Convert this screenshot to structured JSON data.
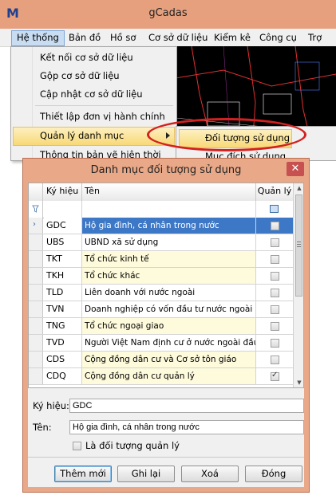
{
  "app": {
    "title": "gCadas",
    "menu": [
      "Hệ thống",
      "Bản đồ",
      "Hồ sơ",
      "Cơ sở dữ liệu",
      "Kiểm kê",
      "Công cụ",
      "Trợ giú"
    ]
  },
  "dropdown": {
    "items": [
      "Kết nối cơ sở dữ liệu",
      "Gộp cơ sở dữ liệu",
      "Cập nhật cơ sở dữ liệu",
      "Thiết lập đơn vị hành chính",
      "Quản lý danh mục",
      "Thông tin bản vẽ hiện thời"
    ],
    "submenu": [
      "Đối tượng sử dụng",
      "Mục đích sử dụng"
    ]
  },
  "dialog": {
    "title": "Danh mục đối tượng sử dụng",
    "close": "✕",
    "columns": {
      "code": "Ký hiệu",
      "name": "Tên",
      "managed": "Quản lý"
    },
    "rows": [
      {
        "code": "GDC",
        "name": "Hộ gia đình, cá nhân trong nước",
        "managed": false,
        "style": "selected"
      },
      {
        "code": "UBS",
        "name": "UBND xã sử dụng",
        "managed": false,
        "style": "plain"
      },
      {
        "code": "TKT",
        "name": "Tổ chức kinh tế",
        "managed": false,
        "style": "yellow"
      },
      {
        "code": "TKH",
        "name": "Tổ chức khác",
        "managed": false,
        "style": "yellow"
      },
      {
        "code": "TLD",
        "name": "Liên doanh với nước ngoài",
        "managed": false,
        "style": "plain"
      },
      {
        "code": "TVN",
        "name": "Doanh nghiệp có vốn đầu tư nước ngoài",
        "managed": false,
        "style": "plain"
      },
      {
        "code": "TNG",
        "name": "Tổ chức ngoại giao",
        "managed": false,
        "style": "yellow"
      },
      {
        "code": "TVD",
        "name": "Người Việt Nam định cư ở nước ngoài đầu ...",
        "managed": false,
        "style": "plain"
      },
      {
        "code": "CDS",
        "name": "Cộng đồng dân cư và Cơ sở tôn giáo",
        "managed": false,
        "style": "yellow"
      },
      {
        "code": "CDQ",
        "name": "Cộng đồng dân cư quản lý",
        "managed": true,
        "style": "yellow"
      }
    ],
    "form": {
      "code_label": "Ký hiệu:",
      "code_value": "GDC",
      "name_label": "Tên:",
      "name_value": "Hộ gia đình, cá nhân trong nước",
      "managed_label": "Là đối tượng quản lý"
    },
    "buttons": {
      "add": "Thêm mới",
      "save": "Ghi lại",
      "delete": "Xoá",
      "close": "Đóng"
    }
  },
  "colors": {
    "title_bar": "#e6a07e",
    "dialog_frame": "#e9a887",
    "selection": "#3d78c6",
    "highlight_oval": "#d42020"
  }
}
